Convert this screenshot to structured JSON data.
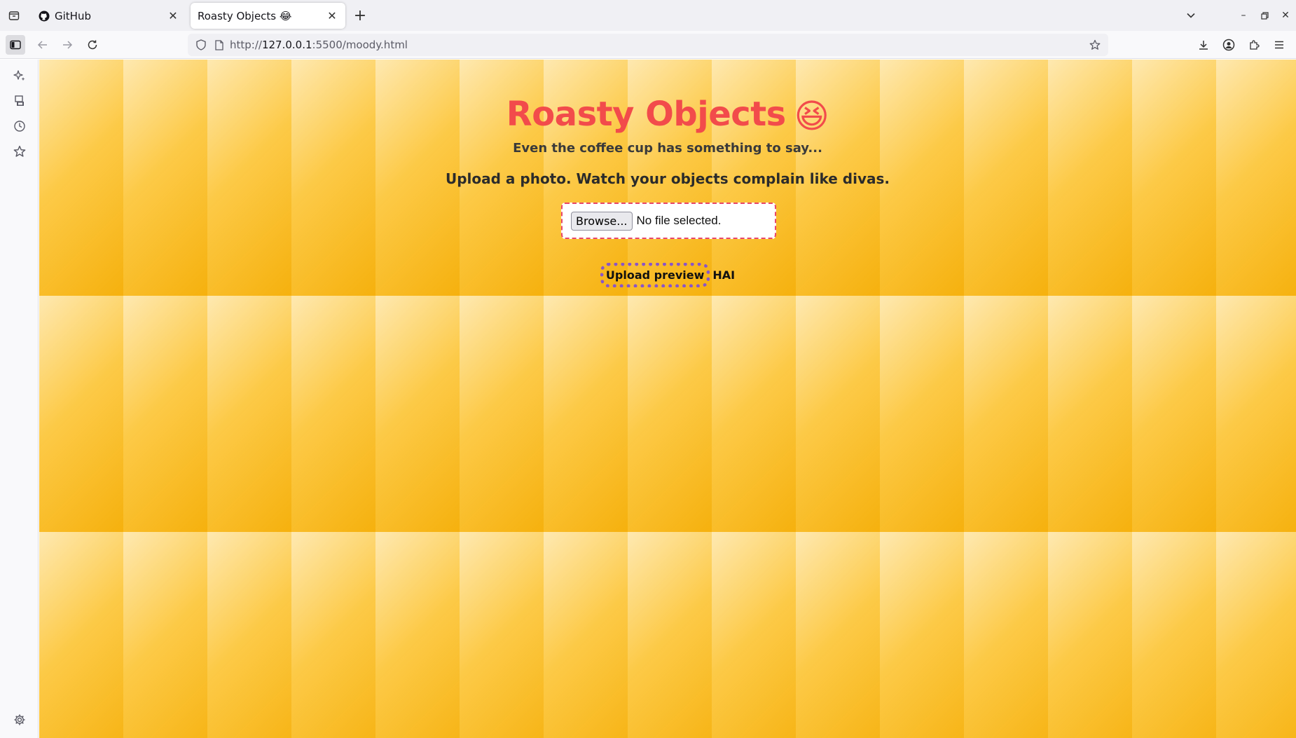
{
  "browser": {
    "tabs": [
      {
        "title": "GitHub",
        "active": false
      },
      {
        "title": "Roasty Objects 😂",
        "active": true
      }
    ],
    "url": {
      "prefix": "http://",
      "host": "127.0.0.1",
      "rest": ":5500/moody.html"
    }
  },
  "page": {
    "heading": "Roasty Objects",
    "heading_emoji": "😆",
    "subtitle": "Even the coffee cup has something to say...",
    "tagline": "Upload a photo. Watch your objects complain like divas.",
    "file_input": {
      "button_label": "Browse...",
      "status": "No file selected."
    },
    "preview_label": "Upload preview",
    "extra_text": "HAI"
  },
  "colors": {
    "heading": "#f24b4b",
    "upload_border": "#e8476a",
    "preview_border": "#8a55c8",
    "background": "#fbc02d"
  }
}
